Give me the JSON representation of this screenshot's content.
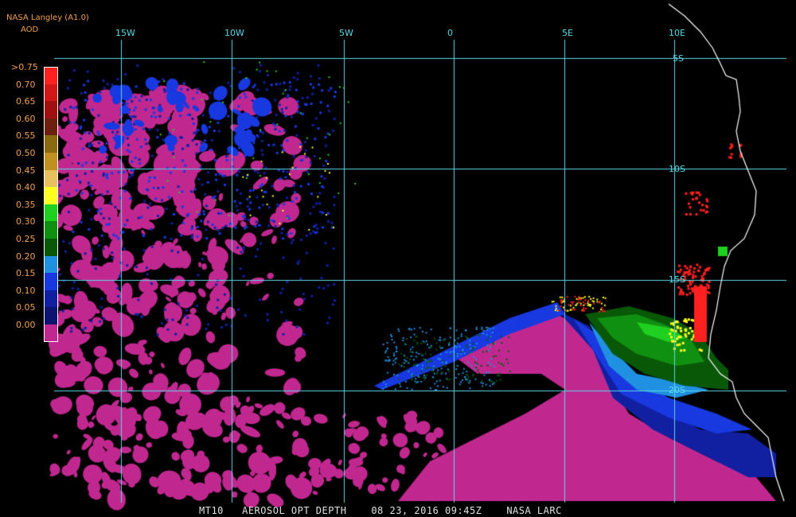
{
  "header": {
    "source": "NASA Langley (A1.0)",
    "variable": "AOD"
  },
  "longitude_labels": [
    "15W",
    "10W",
    "5W",
    "0",
    "5E",
    "10E"
  ],
  "latitude_labels": [
    "5S",
    "10S",
    "15S",
    "20S"
  ],
  "legend": {
    "items": [
      {
        "label": ">0.75",
        "color": "#ff2020"
      },
      {
        "label": "0.70",
        "color": "#d01818"
      },
      {
        "label": "0.65",
        "color": "#a01010"
      },
      {
        "label": "0.60",
        "color": "#6e2010"
      },
      {
        "label": "0.55",
        "color": "#8a6a10"
      },
      {
        "label": "0.50",
        "color": "#c09020"
      },
      {
        "label": "0.45",
        "color": "#e8c060"
      },
      {
        "label": "0.40",
        "color": "#ffff20"
      },
      {
        "label": "0.35",
        "color": "#20d020"
      },
      {
        "label": "0.30",
        "color": "#109010"
      },
      {
        "label": "0.25",
        "color": "#085808"
      },
      {
        "label": "0.20",
        "color": "#2090e0"
      },
      {
        "label": "0.15",
        "color": "#1838e0"
      },
      {
        "label": "0.10",
        "color": "#1020a0"
      },
      {
        "label": "0.05",
        "color": "#0c1470"
      },
      {
        "label": "0.00",
        "color": "#c02890"
      }
    ]
  },
  "footer": {
    "product": "MT10",
    "parameter": "AEROSOL OPT DEPTH",
    "date": "08 23, 2016",
    "time": "09:45Z",
    "agency": "NASA LARC"
  },
  "colors": {
    "grid": "#5cd8e8",
    "coast": "#ffffff",
    "label_orange": "#f0a050",
    "background": "#000000"
  }
}
